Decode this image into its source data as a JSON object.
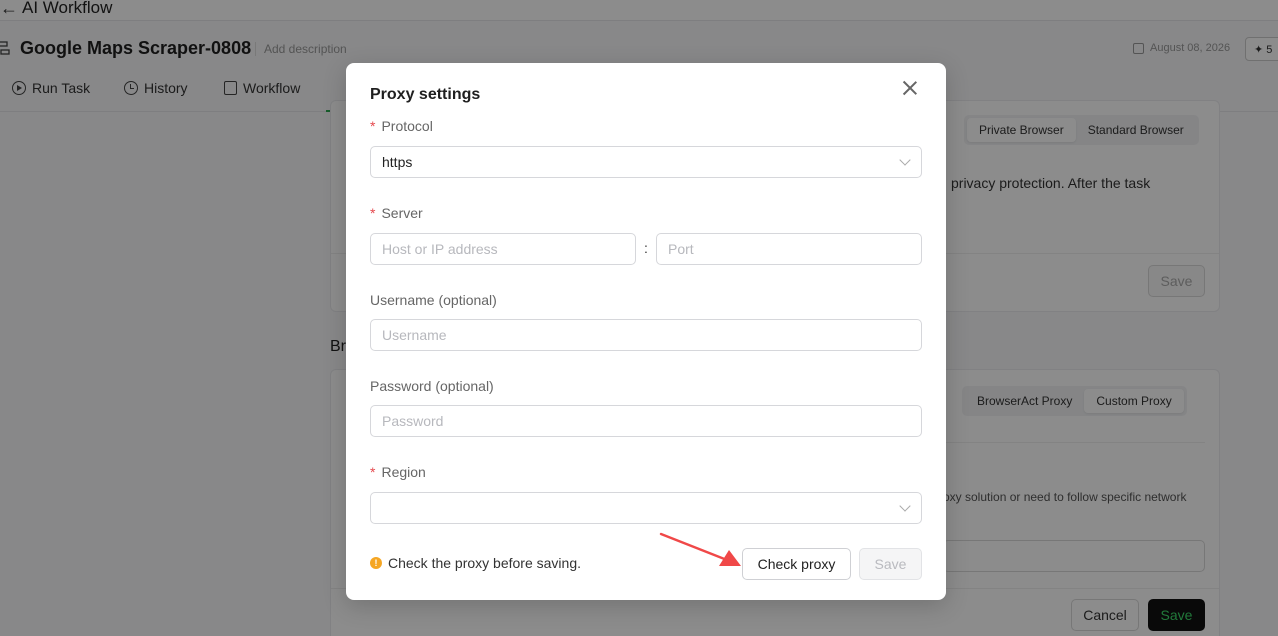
{
  "app": {
    "back_icon": "arrow-left-icon",
    "title": "AI Workflow"
  },
  "workflow": {
    "name": "Google Maps Scraper-0808",
    "add_description": "Add description",
    "date": "August 08, 2026",
    "credits_partial": "5"
  },
  "tabs": [
    {
      "label": "Run Task",
      "icon": "play-circle-icon"
    },
    {
      "label": "History",
      "icon": "clock-icon"
    },
    {
      "label": "Workflow",
      "icon": "workflow-icon"
    }
  ],
  "background": {
    "browser_seg": [
      "Private Browser",
      "Standard Browser"
    ],
    "browser_text": "privacy protection. After the task",
    "save": "Save",
    "section_label": "Br",
    "proxy_seg": [
      "BrowserAct Proxy",
      "Custom Proxy"
    ],
    "proxy_text": "oxy solution or need to follow specific network",
    "cancel": "Cancel",
    "save_dark": "Save"
  },
  "modal": {
    "title": "Proxy settings",
    "protocol": {
      "label": "Protocol",
      "required": "*",
      "value": "https"
    },
    "server": {
      "label": "Server",
      "required": "*",
      "host_placeholder": "Host or IP address",
      "separator": ":",
      "port_placeholder": "Port"
    },
    "username": {
      "label": "Username (optional)",
      "placeholder": "Username"
    },
    "password": {
      "label": "Password (optional)",
      "placeholder": "Password"
    },
    "region": {
      "label": "Region",
      "required": "*",
      "value": ""
    },
    "warning": "Check the proxy before saving.",
    "check_button": "Check proxy",
    "save_button": "Save"
  },
  "colors": {
    "accent_green": "#2aa84f",
    "required_red": "#e5484d",
    "warning_orange": "#f5a623",
    "arrow_red": "#f04848"
  }
}
